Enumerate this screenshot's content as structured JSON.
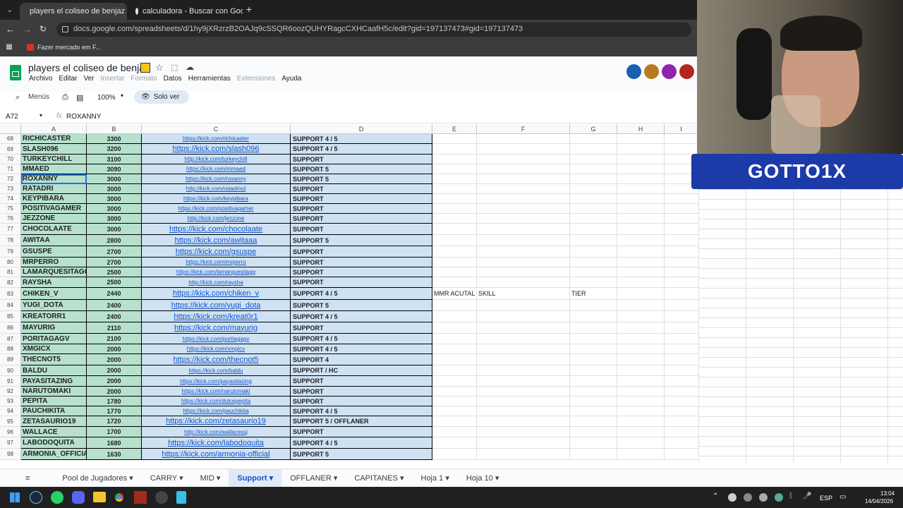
{
  "browser": {
    "tabs": [
      {
        "title": "players el coliseo de benjaz - H"
      },
      {
        "title": "calculadora - Buscar con Googl"
      }
    ],
    "url": "docs.google.com/spreadsheets/d/1hy9jXRzrzB2OAJq9cSSQR6oozQUHYRagcCXHCaafH5c/edit?gid=197137473#gid=197137473",
    "bookmark": "Fazer mercado em F..."
  },
  "doc": {
    "title": "players el coliseo de benjaz",
    "menus": [
      "Archivo",
      "Editar",
      "Ver",
      "Insertar",
      "Formato",
      "Datos",
      "Herramientas",
      "Extensiones",
      "Ayuda"
    ],
    "search_label": "Menús",
    "zoom": "100%",
    "mode": "Solo ver"
  },
  "formula": {
    "cell": "A72",
    "value": "ROXANNY"
  },
  "columns": [
    "A",
    "B",
    "C",
    "D",
    "E",
    "F",
    "G",
    "H",
    "I"
  ],
  "rows": [
    {
      "n": "68",
      "a": "RICHICASTER",
      "b": "3300",
      "c": "https://kick.com/richicaster",
      "d": "SUPPORT 4 / 5"
    },
    {
      "n": "69",
      "a": "SLASH096",
      "b": "3200",
      "c": "https://kick.com/slash096",
      "d": "SUPPORT 4 / 5"
    },
    {
      "n": "70",
      "a": "TURKEYCHILL",
      "b": "3100",
      "c": "http://kick.com/turkeychill",
      "d": "SUPPORT"
    },
    {
      "n": "71",
      "a": "MMAED",
      "b": "3090",
      "c": "https://kick.com/mmaed",
      "d": "SUPPORT 5"
    },
    {
      "n": "72",
      "a": "ROXANNY",
      "b": "3000",
      "c": "https://kick.com/roxanny",
      "d": "SUPPORT 5"
    },
    {
      "n": "73",
      "a": "RATADRI",
      "b": "3000",
      "c": "http://kick.com/ratadrixd",
      "d": "SUPPORT"
    },
    {
      "n": "74",
      "a": "KEYPIBARA",
      "b": "3000",
      "c": "https://kick.com/keypibara",
      "d": "SUPPORT"
    },
    {
      "n": "75",
      "a": "POSITIVAGAMER",
      "b": "3000",
      "c": "https://kick.com/positivagamer",
      "d": "SUPPORT"
    },
    {
      "n": "76",
      "a": "JEZZONE",
      "b": "3000",
      "c": "http://kick.com/jezzone",
      "d": "SUPPORT"
    },
    {
      "n": "77",
      "a": "CHOCOLAATE",
      "b": "3000",
      "c": "https://kick.com/chocolaate",
      "d": "SUPPORT"
    },
    {
      "n": "78",
      "a": "AWITAA",
      "b": "2800",
      "c": "https://kick.com/awitaaa",
      "d": "SUPPORT 5"
    },
    {
      "n": "79",
      "a": "GSUSPE",
      "b": "2700",
      "c": "https://kick.com/gsuspe",
      "d": "SUPPORT"
    },
    {
      "n": "80",
      "a": "MRPERRO",
      "b": "2700",
      "c": "https://kick.com/mrperro",
      "d": "SUPPORT"
    },
    {
      "n": "81",
      "a": "LAMARQUESITAGG",
      "b": "2500",
      "c": "https://kick.com/lamarquesitagg",
      "d": "SUPPORT"
    },
    {
      "n": "82",
      "a": "RAYSHA",
      "b": "2500",
      "c": "http://kick.com/raysha",
      "d": "SUPPORT"
    },
    {
      "n": "83",
      "a": "CHIKEN_V",
      "b": "2440",
      "c": "https://kick.com/chiken_v",
      "d": "SUPPORT 4 / 5",
      "e": "MMR ACUTAL",
      "f": "SKILL",
      "g": "TIER"
    },
    {
      "n": "84",
      "a": "YUGI_DOTA",
      "b": "2400",
      "c": "https://kick.com/yugi_dota",
      "d": "SUPPORT 5"
    },
    {
      "n": "85",
      "a": "KREATORR1",
      "b": "2400",
      "c": "https://kick.com/kreat0r1",
      "d": "SUPPORT 4 / 5"
    },
    {
      "n": "86",
      "a": "MAYURIG",
      "b": "2110",
      "c": "https://kick.com/mayurig",
      "d": "SUPPORT"
    },
    {
      "n": "87",
      "a": "PORITAGAGV",
      "b": "2100",
      "c": "https://kick.com/poritagagv",
      "d": "SUPPORT 4 / 5"
    },
    {
      "n": "88",
      "a": "XMGICX",
      "b": "2000",
      "c": "https://kick.com/xmgicx",
      "d": "SUPPORT 4 / 5"
    },
    {
      "n": "89",
      "a": "THECNOT5",
      "b": "2000",
      "c": "https://kick.com/thecnot5",
      "d": "SUPPORT 4"
    },
    {
      "n": "90",
      "a": "BALDU",
      "b": "2000",
      "c": "https://kick.com/baldu",
      "d": "SUPPORT / HC"
    },
    {
      "n": "91",
      "a": "PAYASITAZING",
      "b": "2000",
      "c": "https://kick.com/payasitazing",
      "d": "SUPPORT"
    },
    {
      "n": "92",
      "a": "NARUTOMAKI",
      "b": "2000",
      "c": "https://kick.com/narutomaki",
      "d": "SUPPORT"
    },
    {
      "n": "93",
      "a": "PEPITA",
      "b": "1780",
      "c": "https://kick.com/dulcepepita",
      "d": "SUPPORT"
    },
    {
      "n": "94",
      "a": "PAUCHIKITA",
      "b": "1770",
      "c": "https://kick.com/pauchikita",
      "d": "SUPPORT 4 / 5"
    },
    {
      "n": "95",
      "a": "ZETASAURIO19",
      "b": "1720",
      "c": "https://kick.com/zetasaurio19",
      "d": "SUPPORT 5 / OFFLANER"
    },
    {
      "n": "96",
      "a": "WALLACE",
      "b": "1700",
      "c": "http://kick.com/wallacessj",
      "d": "SUPPORT"
    },
    {
      "n": "97",
      "a": "LABODOQUITA",
      "b": "1680",
      "c": "https://kick.com/labodoquita",
      "d": "SUPPORT 4 / 5"
    },
    {
      "n": "98",
      "a": "ARMONIA_OFFICIAL",
      "b": "1630",
      "c": "https://kick.com/armonia-official",
      "d": "SUPPORT 5"
    }
  ],
  "sheet_tabs": [
    "Pool de Jugadores",
    "CARRY",
    "MID",
    "Support",
    "OFFLANER",
    "CAPITANES",
    "Hoja 1",
    "Hoja 10"
  ],
  "active_sheet": "Support",
  "overlay": {
    "name": "GOTTO1X"
  },
  "taskbar": {
    "lang": "ESP",
    "time": "13:04",
    "date": "14/04/2026"
  }
}
